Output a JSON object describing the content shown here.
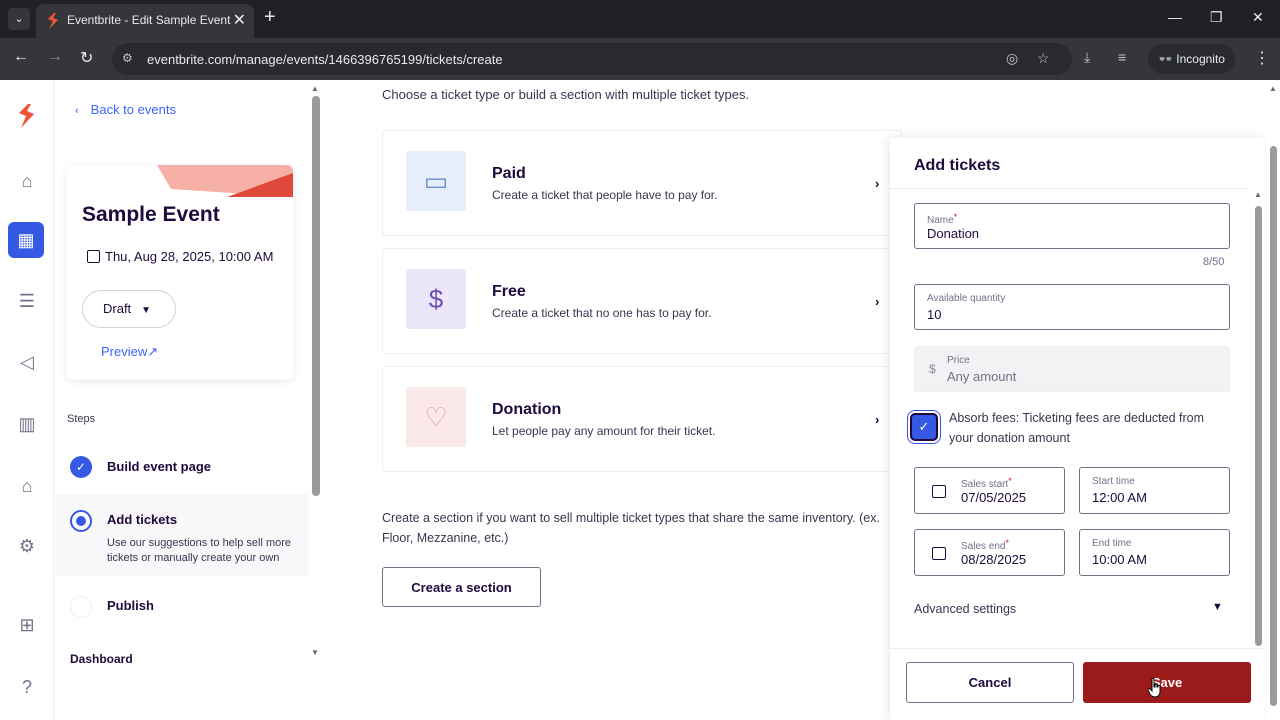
{
  "browser": {
    "tab_title": "Eventbrite - Edit Sample Event",
    "url": "eventbrite.com/manage/events/1466396765199/tickets/create",
    "incognito_label": "Incognito"
  },
  "sidebar": {
    "back_label": "Back to events",
    "event": {
      "name": "Sample Event",
      "date": "Thu, Aug 28, 2025, 10:00 AM",
      "status": "Draft",
      "preview_label": "Preview"
    },
    "steps_label": "Steps",
    "steps": [
      {
        "title": "Build event page",
        "state": "done"
      },
      {
        "title": "Add tickets",
        "state": "current",
        "description": "Use our suggestions to help sell more tickets or manually create your own"
      },
      {
        "title": "Publish",
        "state": "todo"
      }
    ],
    "dashboard_label": "Dashboard"
  },
  "main": {
    "intro": "Choose a ticket type or build a section with multiple ticket types.",
    "ticket_types": [
      {
        "title": "Paid",
        "description": "Create a ticket that people have to pay for.",
        "icon": "ticket-icon"
      },
      {
        "title": "Free",
        "description": "Create a ticket that no one has to pay for.",
        "icon": "no-dollar-icon"
      },
      {
        "title": "Donation",
        "description": "Let people pay any amount for their ticket.",
        "icon": "heart-icon"
      }
    ],
    "section_text": "Create a section if you want to sell multiple ticket types that share the same inventory. (ex. Floor, Mezzanine, etc.)",
    "create_section_label": "Create a section"
  },
  "panel": {
    "title": "Add tickets",
    "name": {
      "label": "Name",
      "value": "Donation",
      "counter": "8/50"
    },
    "quantity": {
      "label": "Available quantity",
      "value": "10"
    },
    "price": {
      "label": "Price",
      "placeholder": "Any amount",
      "symbol": "$"
    },
    "absorb_fees": {
      "checked": true,
      "label": "Absorb fees: Ticketing fees are deducted from your donation amount"
    },
    "sales_start": {
      "label": "Sales start",
      "value": "07/05/2025"
    },
    "start_time": {
      "label": "Start time",
      "value": "12:00 AM"
    },
    "sales_end": {
      "label": "Sales end",
      "value": "08/28/2025"
    },
    "end_time": {
      "label": "End time",
      "value": "10:00 AM"
    },
    "advanced_label": "Advanced settings",
    "cancel_label": "Cancel",
    "save_label": "Save"
  },
  "colors": {
    "brand": "#f05537",
    "accent": "#3659e3",
    "save": "#9b1b1b"
  }
}
